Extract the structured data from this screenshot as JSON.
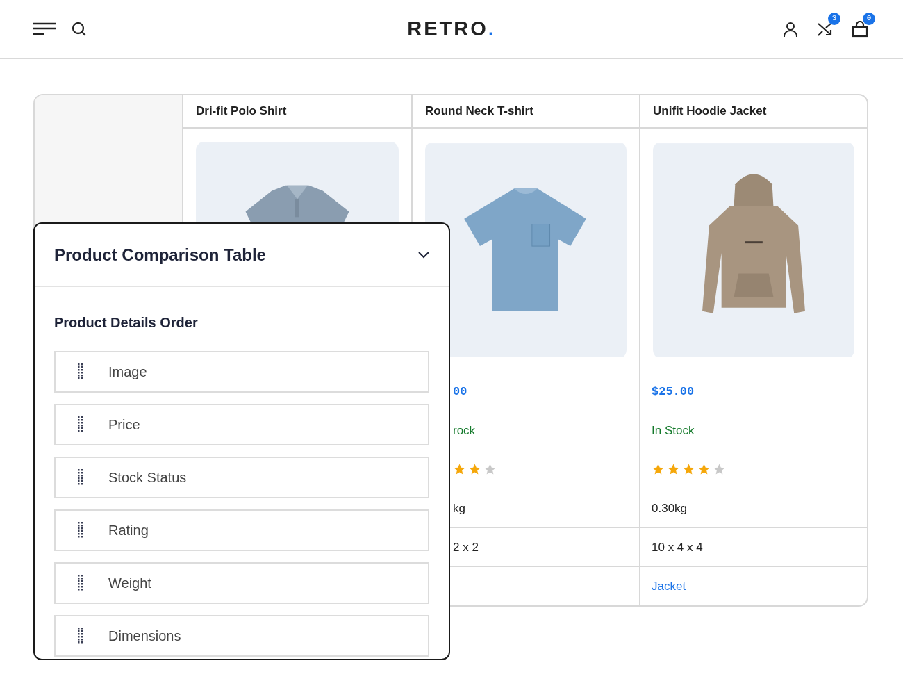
{
  "header": {
    "logo": "RETRO",
    "logo_mark": ".",
    "compare_count": "3",
    "cart_count": "0"
  },
  "products": [
    {
      "name": "Dri-fit Polo Shirt"
    },
    {
      "name": "Round Neck T-shirt",
      "cropped": true,
      "price": "00",
      "stock": "rock",
      "stars": 2,
      "weight": "kg",
      "dimensions": "2 x 2"
    },
    {
      "name": "Unifit Hoodie Jacket",
      "cropped": false,
      "price": "$25.00",
      "stock": "In Stock",
      "stars": 4,
      "weight": "0.30kg",
      "dimensions": "10 x 4 x 4",
      "category": "Jacket"
    }
  ],
  "panel": {
    "title": "Product Comparison Table",
    "section": "Product Details Order",
    "items": [
      "Image",
      "Price",
      "Stock Status",
      "Rating",
      "Weight",
      "Dimensions"
    ]
  }
}
